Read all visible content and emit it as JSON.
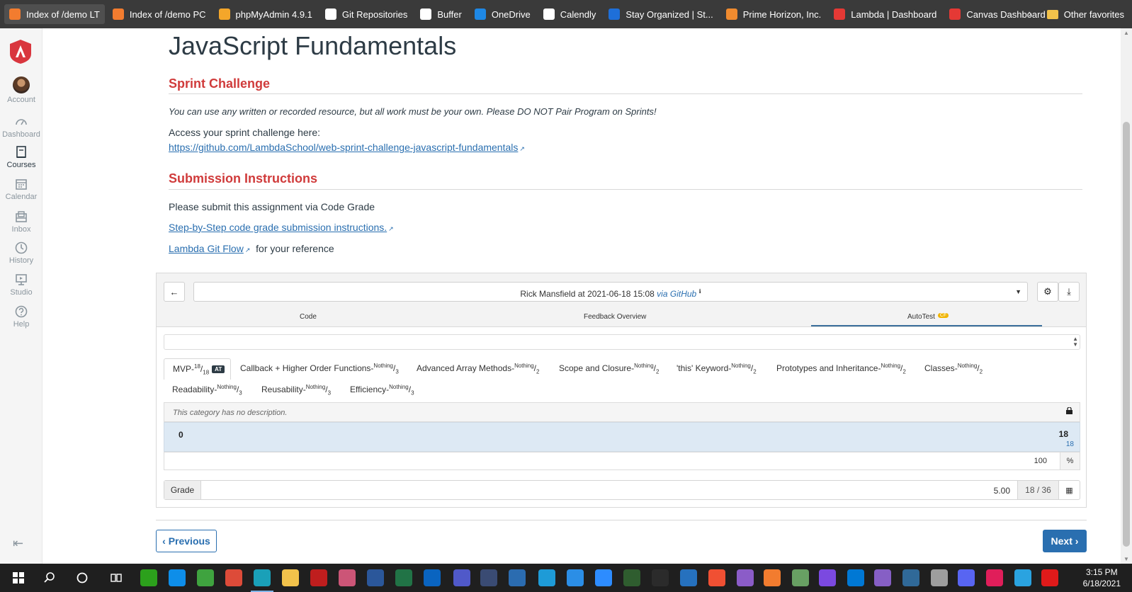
{
  "bookmarks": [
    {
      "label": "Index of /demo LT",
      "icon": "xampp-icon",
      "color": "#f27c2f"
    },
    {
      "label": "Index of /demo PC",
      "icon": "xampp-icon",
      "color": "#f27c2f"
    },
    {
      "label": "phpMyAdmin 4.9.1",
      "icon": "phpmyadmin-icon",
      "color": "#f4a62a"
    },
    {
      "label": "Git Repositories",
      "icon": "github-icon",
      "color": "#ffffff"
    },
    {
      "label": "Buffer",
      "icon": "buffer-icon",
      "color": "#ffffff"
    },
    {
      "label": "OneDrive",
      "icon": "onedrive-icon",
      "color": "#1e88e5"
    },
    {
      "label": "Calendly",
      "icon": "calendly-icon",
      "color": "#ffffff"
    },
    {
      "label": "Stay Organized | St...",
      "icon": "stay-organized-icon",
      "color": "#1e6fd9"
    },
    {
      "label": "Prime Horizon, Inc.",
      "icon": "prime-horizon-icon",
      "color": "#f08b2f"
    },
    {
      "label": "Lambda | Dashboard",
      "icon": "lambda-icon",
      "color": "#e53935"
    },
    {
      "label": "Canvas Dashboard",
      "icon": "lambda-icon",
      "color": "#e53935"
    }
  ],
  "other_favorites": "Other favorites",
  "nav": {
    "account": "Account",
    "dashboard": "Dashboard",
    "courses": "Courses",
    "calendar": "Calendar",
    "inbox": "Inbox",
    "history": "History",
    "studio": "Studio",
    "help": "Help"
  },
  "page": {
    "title": "JavaScript Fundamentals",
    "sprint_heading": "Sprint Challenge",
    "sprint_note": "You can use any written or recorded resource, but all work must be your own. Please DO NOT Pair Program on Sprints!",
    "access_text": "Access your sprint challenge here:",
    "repo_link": "https://github.com/LambdaSchool/web-sprint-challenge-javascript-fundamentals",
    "submission_heading": "Submission Instructions",
    "submit_text": "Please submit this assignment via Code Grade",
    "step_link": "Step-by-Step code grade submission instructions.",
    "gitflow_link": "Lambda Git Flow",
    "gitflow_suffix": "for your reference"
  },
  "codegrade": {
    "submission_by": "Rick Mansfield at 2021-06-18 15:08",
    "via": "via",
    "source": "GitHub",
    "tabs": [
      "Code",
      "Feedback Overview",
      "AutoTest"
    ],
    "autotest_badge": "CF",
    "rubric": [
      {
        "name": "MVP",
        "score": "18",
        "max": "18",
        "badge": "AT"
      },
      {
        "name": "Callback + Higher Order Functions",
        "score": "Nothing",
        "max": "3"
      },
      {
        "name": "Advanced Array Methods",
        "score": "Nothing",
        "max": "2"
      },
      {
        "name": "Scope and Closure",
        "score": "Nothing",
        "max": "2"
      },
      {
        "name": "'this' Keyword",
        "score": "Nothing",
        "max": "2"
      },
      {
        "name": "Prototypes and Inheritance",
        "score": "Nothing",
        "max": "2"
      },
      {
        "name": "Classes",
        "score": "Nothing",
        "max": "2"
      },
      {
        "name": "Readability",
        "score": "Nothing",
        "max": "3"
      },
      {
        "name": "Reusability",
        "score": "Nothing",
        "max": "3"
      },
      {
        "name": "Efficiency",
        "score": "Nothing",
        "max": "3"
      }
    ],
    "category_desc": "This category has no description.",
    "item_left": "0",
    "item_right": "18",
    "item_right_sub": "18",
    "percent_value": "100",
    "percent_unit": "%",
    "grade_label": "Grade",
    "grade_value": "5.00",
    "grade_fraction": "18 / 36"
  },
  "footer": {
    "previous": "Previous",
    "next": "Next"
  },
  "taskbar": {
    "time": "3:15 PM",
    "date": "6/18/2021"
  }
}
